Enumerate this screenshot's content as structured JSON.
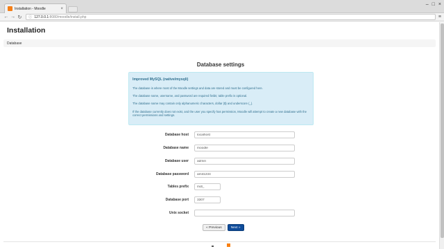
{
  "browser": {
    "tab_title": "Installation - Moodle",
    "tab_close": "×",
    "url_host": "127.0.0.1",
    "url_path": ":8080/moodle/install.php",
    "back": "←",
    "forward": "→",
    "reload": "↻",
    "menu": "≡",
    "win_min": "–",
    "win_max": "□",
    "win_close": "×"
  },
  "page": {
    "heading": "Installation",
    "breadcrumb": "Database",
    "section_title": "Database settings",
    "info": {
      "title": "Improved MySQL (native/mysqli)",
      "p1": "The database is where most of the Moodle settings and data are stored and must be configured here.",
      "p2": "The database name, username, and password are required fields; table prefix is optional.",
      "p3": "The database name may contain only alphanumeric characters, dollar ($) and underscore (_).",
      "p4": "If the database currently does not exist, and the user you specify has permission, Moodle will attempt to create a new database with the correct permissions and settings."
    },
    "fields": {
      "dbhost": {
        "label": "Database host",
        "value": "localhost"
      },
      "dbname": {
        "label": "Database name",
        "value": "moodle"
      },
      "dbuser": {
        "label": "Database user",
        "value": "admin"
      },
      "dbpass": {
        "label": "Database password",
        "value": "amit1234"
      },
      "prefix": {
        "label": "Tables prefix",
        "value": "mdl_"
      },
      "dbport": {
        "label": "Database port",
        "value": "3307"
      },
      "dbsocket": {
        "label": "Unix socket",
        "value": ""
      }
    },
    "buttons": {
      "previous": "« Previous",
      "next": "Next »"
    }
  },
  "colors": {
    "info_bg": "#d9edf7",
    "info_text": "#31708f",
    "primary_button": "#0f4c9a"
  }
}
